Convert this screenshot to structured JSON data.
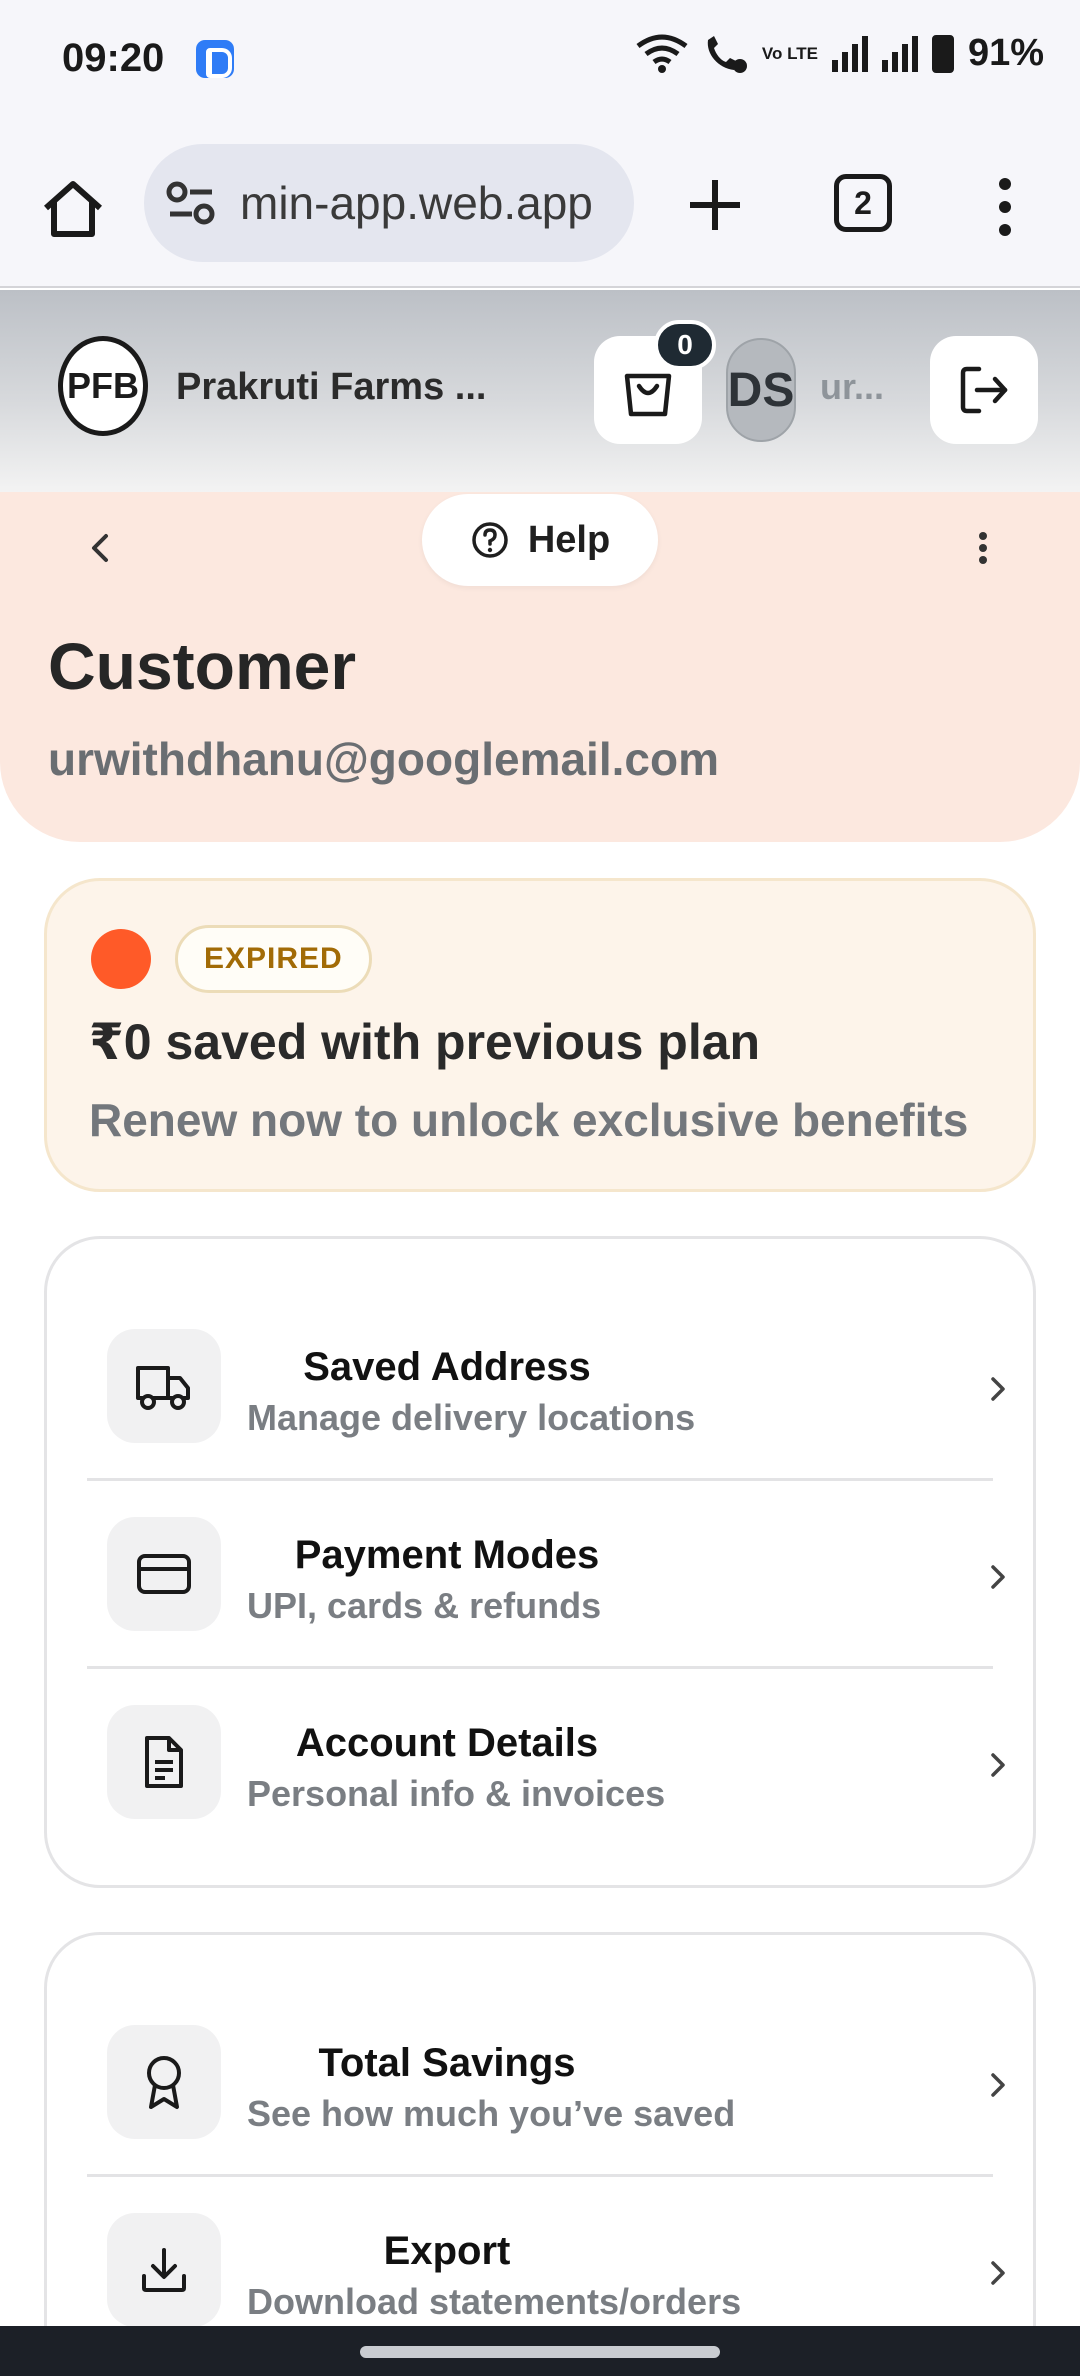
{
  "status_bar": {
    "time": "09:20",
    "volte": "Vo LTE",
    "battery": "91%"
  },
  "browser": {
    "url": "min-app.web.app",
    "tab_count": "2"
  },
  "app_header": {
    "logo_text": "PFB",
    "brand": "Prakruti Farms ...",
    "cart_count": "0",
    "avatar_initials": "DS",
    "username": "ur..."
  },
  "profile": {
    "help_label": "Help",
    "title": "Customer",
    "email": "urwithdhanu@googlemail.com"
  },
  "membership": {
    "status": "EXPIRED",
    "status_dot_color": "#ff5a28",
    "saved_text": "₹0 saved with previous plan",
    "renew_text": "Renew now to unlock exclusive benefits"
  },
  "menu_group_1": [
    {
      "icon": "truck-icon",
      "title": "Saved Address",
      "subtitle": "Manage delivery locations"
    },
    {
      "icon": "credit-card-icon",
      "title": "Payment Modes",
      "subtitle": "UPI, cards & refunds"
    },
    {
      "icon": "document-icon",
      "title": "Account Details",
      "subtitle": "Personal info & invoices"
    }
  ],
  "menu_group_2": [
    {
      "icon": "award-icon",
      "title": "Total Savings",
      "subtitle": "See how much you’ve saved"
    },
    {
      "icon": "download-icon",
      "title": "Export",
      "subtitle": "Download statements/orders"
    }
  ],
  "colors": {
    "profile_bg": "#fce8df",
    "member_bg": "#fdf4ea",
    "expired_text": "#a26b06"
  }
}
